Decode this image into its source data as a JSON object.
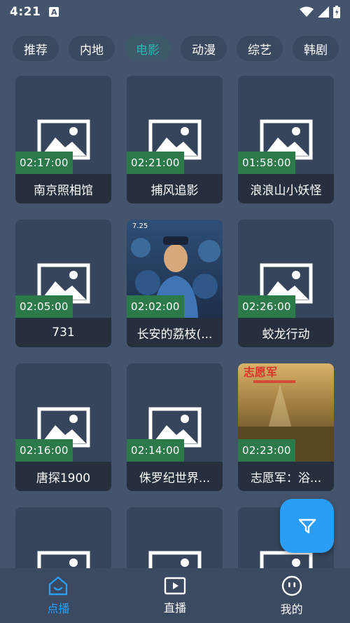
{
  "status_bar": {
    "time": "4:21",
    "app_badge": "A"
  },
  "tabs": [
    {
      "label": "推荐",
      "active": false
    },
    {
      "label": "内地",
      "active": false
    },
    {
      "label": "电影",
      "active": true
    },
    {
      "label": "动漫",
      "active": false
    },
    {
      "label": "综艺",
      "active": false
    },
    {
      "label": "韩剧",
      "active": false
    }
  ],
  "videos": [
    {
      "title": "南京照相馆",
      "duration": "02:17:00",
      "poster": "placeholder"
    },
    {
      "title": "捕风追影",
      "duration": "02:21:00",
      "poster": "placeholder"
    },
    {
      "title": "浪浪山小妖怪",
      "duration": "01:58:00",
      "poster": "placeholder"
    },
    {
      "title": "731",
      "duration": "02:05:00",
      "poster": "placeholder"
    },
    {
      "title": "长安的荔枝(...",
      "duration": "02:02:00",
      "poster": "image"
    },
    {
      "title": "蛟龙行动",
      "duration": "02:26:00",
      "poster": "placeholder"
    },
    {
      "title": "唐探1900",
      "duration": "02:16:00",
      "poster": "placeholder"
    },
    {
      "title": "侏罗纪世界...",
      "duration": "02:14:00",
      "poster": "placeholder"
    },
    {
      "title": "志愿军：浴...",
      "duration": "02:23:00",
      "poster": "image"
    },
    {
      "title": "",
      "duration": "",
      "poster": "placeholder"
    },
    {
      "title": "",
      "duration": "",
      "poster": "placeholder"
    },
    {
      "title": "",
      "duration": "",
      "poster": "placeholder"
    }
  ],
  "fab": {
    "icon": "filter-icon"
  },
  "bottom_nav": [
    {
      "label": "点播",
      "icon": "vod-home-icon",
      "active": true
    },
    {
      "label": "直播",
      "icon": "live-play-icon",
      "active": false
    },
    {
      "label": "我的",
      "icon": "profile-face-icon",
      "active": false
    }
  ],
  "colors": {
    "background": "#44546d",
    "accent": "#2a9df4",
    "active_tab_text": "#26b7b1",
    "duration_badge": "#2c7a4a"
  }
}
